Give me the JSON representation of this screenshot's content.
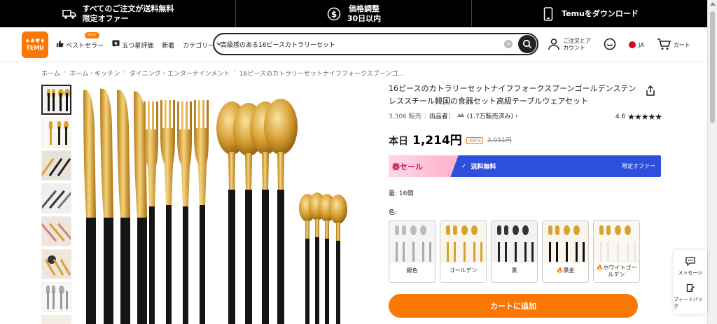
{
  "promo": {
    "item1_line1": "すべてのご注文が送料無料",
    "item1_line2": "限定オファー",
    "item2_line1": "価格調整",
    "item2_line2": "30日以内",
    "item3": "Temuをダウンロード"
  },
  "header": {
    "logo_line1": "♠♣♥♦",
    "logo_line2": "TEMU",
    "nav": {
      "bestseller": "ベストセラー",
      "hot_badge": "HOT",
      "five_star": "五つ星評価",
      "new": "新着",
      "category": "カテゴリー"
    },
    "search": {
      "value": "高級感のある16ピースカトラリーセット",
      "clear_icon": "×"
    },
    "account": {
      "line1": "ご注文とア",
      "line2": "カウント"
    },
    "language": "JA",
    "cart": "カート"
  },
  "breadcrumb": {
    "items": [
      "ホーム",
      "ホーム・キッチン",
      "ダイニング・エンターテインメント",
      "16ピースのカトラリーセットナイフフォークスプーンゴ..."
    ],
    "sep": "›"
  },
  "product": {
    "title": "16ピースのカトラリーセットナイフフォークスプーンゴールデンステンレススチール韓国の食器セット高級テーブルウェアセット",
    "sold": "3,306 販売",
    "seller_label": "出品者：",
    "seller_sales": "(1.7万販売済み)",
    "seller_chevron": "›",
    "rating": "4.6",
    "stars": "★★★★★",
    "price_label": "本日",
    "price": "1,214円",
    "discount": "-69%",
    "original_price": "3,951円",
    "banner": {
      "sale": "春セール",
      "check": "✓",
      "free_shipping": "送料無料",
      "limited": "限定オファー"
    },
    "quantity": "量: 16個",
    "color_label": "色:",
    "colors": [
      {
        "label": "銀色",
        "fire": ""
      },
      {
        "label": "ゴールデン",
        "fire": ""
      },
      {
        "label": "黒",
        "fire": ""
      },
      {
        "label": "黒金",
        "fire": "🔥"
      },
      {
        "label": "ホワイトゴールデン",
        "fire": "🔥"
      }
    ],
    "add_to_cart": "カートに追加"
  },
  "float": {
    "message": "メッセージ",
    "feedback": "フィードバック"
  },
  "colors": {
    "accent": "#fb7701",
    "banner_blue": "#2d4fdc",
    "black": "#000000",
    "gold": "#d8a232"
  }
}
